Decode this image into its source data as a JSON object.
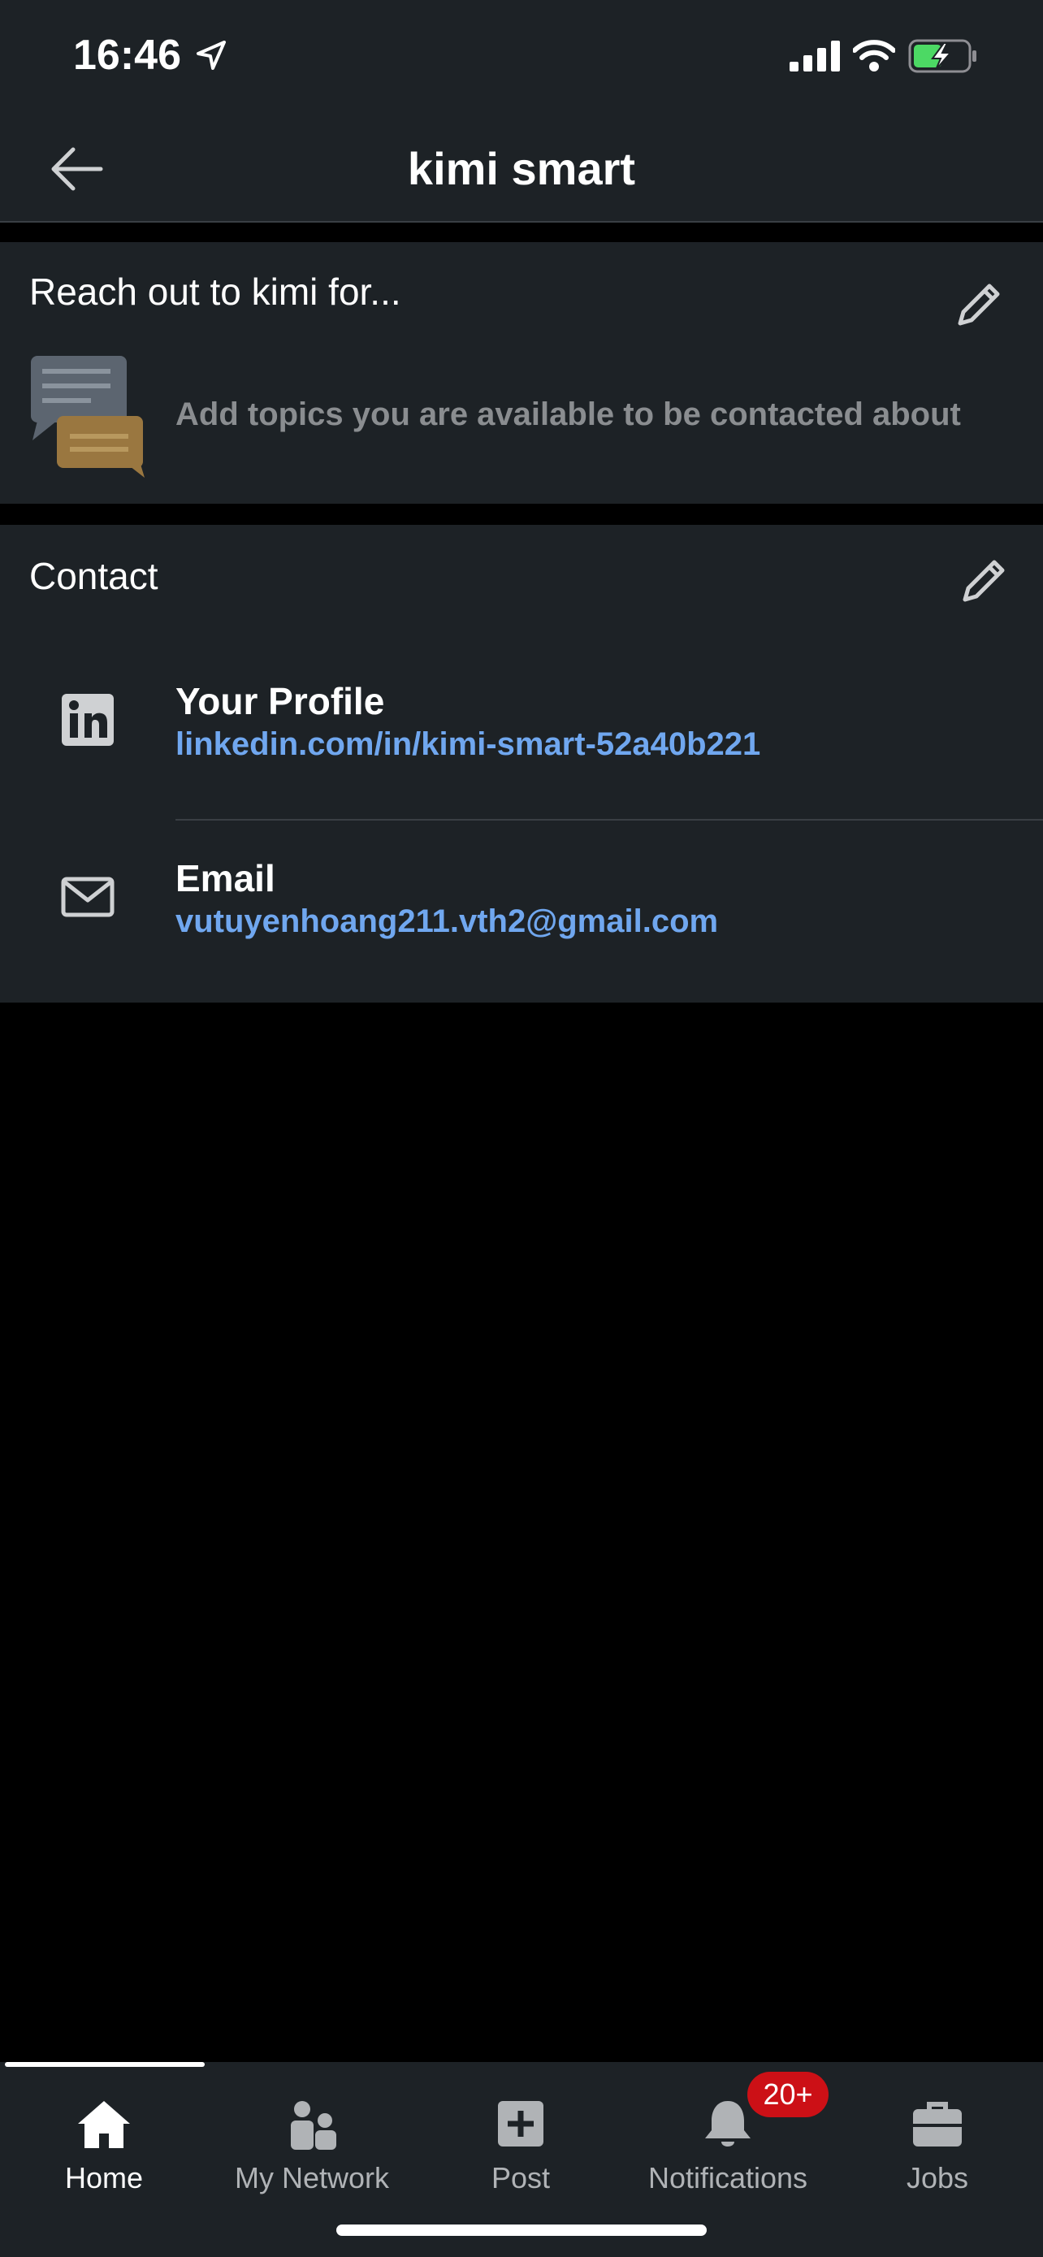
{
  "status_bar": {
    "time": "16:46"
  },
  "header": {
    "title": "kimi smart"
  },
  "reach_out": {
    "title": "Reach out to kimi for...",
    "empty_text": "Add topics you are available to be contacted about"
  },
  "contact": {
    "title": "Contact",
    "items": [
      {
        "label": "Your Profile",
        "value": "linkedin.com/in/kimi-smart-52a40b221",
        "icon": "linkedin-icon"
      },
      {
        "label": "Email",
        "value": "vutuyenhoang211.vth2@gmail.com",
        "icon": "mail-icon"
      }
    ]
  },
  "tab_bar": {
    "tabs": [
      {
        "label": "Home",
        "icon": "home-icon",
        "active": true
      },
      {
        "label": "My Network",
        "icon": "people-icon",
        "active": false
      },
      {
        "label": "Post",
        "icon": "plus-square-icon",
        "active": false
      },
      {
        "label": "Notifications",
        "icon": "bell-icon",
        "active": false
      },
      {
        "label": "Jobs",
        "icon": "briefcase-icon",
        "active": false
      }
    ],
    "notifications_badge": "20+"
  },
  "colors": {
    "background": "#000000",
    "surface": "#1d2226",
    "link": "#70a7ef",
    "badge": "#cc1016"
  }
}
